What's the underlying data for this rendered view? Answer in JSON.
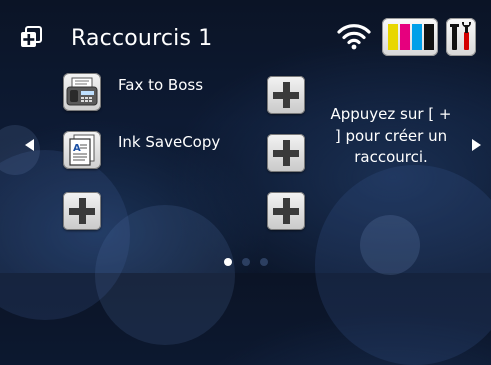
{
  "header": {
    "title": "Raccourcis 1",
    "icons": [
      "shortcut-add-icon",
      "wifi-icon",
      "ink-levels-icon",
      "tools-icon"
    ]
  },
  "ink_colors": [
    "#e8d700",
    "#e6007e",
    "#00a0e9",
    "#111111"
  ],
  "shortcuts": [
    {
      "label": "Fax to Boss",
      "icon": "fax-icon"
    },
    {
      "label": "Ink SaveCopy",
      "icon": "copy-document-icon"
    }
  ],
  "hint": "Appuyez sur [ + ] pour créer un raccourci.",
  "pagination": {
    "pages": 3,
    "current": 1
  }
}
